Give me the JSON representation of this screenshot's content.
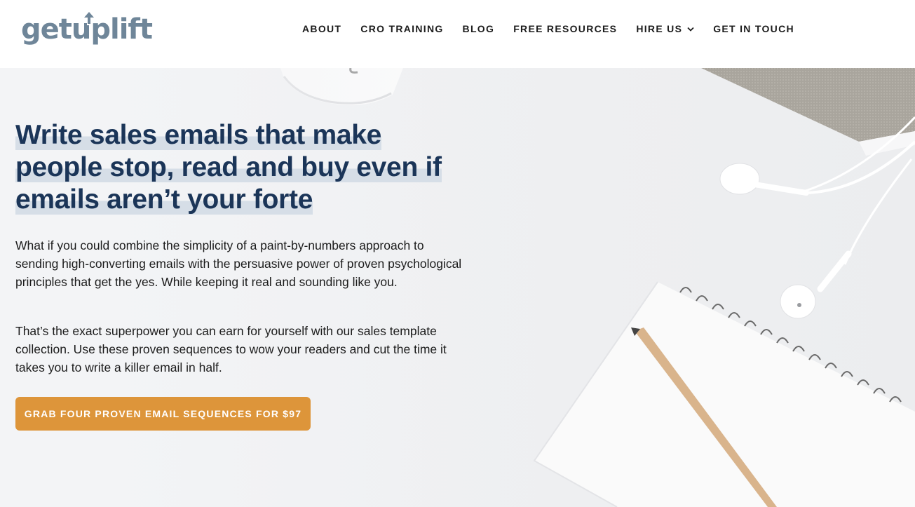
{
  "logo": {
    "text": "getuplift"
  },
  "nav": {
    "items": [
      {
        "label": "ABOUT"
      },
      {
        "label": "CRO TRAINING"
      },
      {
        "label": "BLOG"
      },
      {
        "label": "FREE RESOURCES"
      },
      {
        "label": "HIRE US",
        "has_dropdown": true,
        "dropdown_icon": "chevron-down-icon"
      },
      {
        "label": "GET IN TOUCH"
      }
    ]
  },
  "hero": {
    "headline_lines": [
      "Write sales emails that make",
      "people stop, read and buy even if",
      "emails aren’t your forte"
    ],
    "paragraph1": "What if you could combine the simplicity of a paint-by-numbers approach to sending high-converting emails with the persuasive power of proven psychological principles that get the yes. While keeping it real and sounding like you.",
    "paragraph2": "That’s the exact superpower you can earn for yourself with our sales template collection. Use these proven sequences to wow your readers and cut the time it takes you to write a killer email in half.",
    "cta_label": "GRAB FOUR PROVEN EMAIL SEQUENCES FOR $97"
  },
  "colors": {
    "headline": "#1b3558",
    "cta_background": "#dd953a",
    "headline_highlight": "#d6dee7",
    "logo": "#6f8699"
  }
}
